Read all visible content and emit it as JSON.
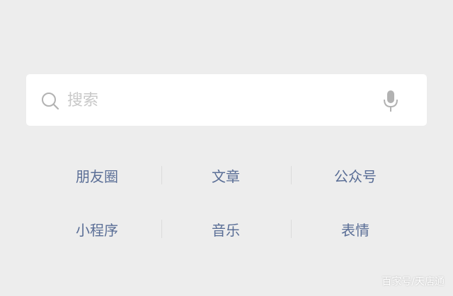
{
  "search": {
    "placeholder": "搜索",
    "value": ""
  },
  "icons": {
    "search": "search-icon",
    "voice": "microphone-icon"
  },
  "categories": [
    [
      "朋友圈",
      "文章",
      "公众号"
    ],
    [
      "小程序",
      "音乐",
      "表情"
    ]
  ],
  "watermark": "百家号/天店通",
  "colors": {
    "background": "#ededed",
    "search_box": "#ffffff",
    "category_text": "#5a6e96",
    "placeholder": "#c8c8c8",
    "icon": "#b2b2b2"
  }
}
